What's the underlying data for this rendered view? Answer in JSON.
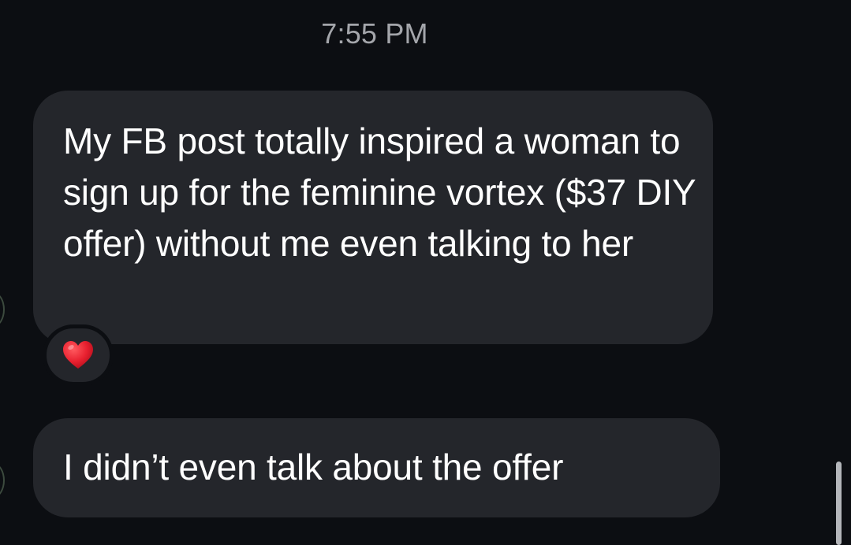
{
  "conversation": {
    "timestamp": "7:55 PM",
    "messages": [
      {
        "text": "My FB post totally inspired a woman to sign up for the feminine vortex ($37 DIY offer) without me even talking to her",
        "reaction": "red-heart"
      },
      {
        "text": "I didn’t even talk about the offer"
      }
    ]
  },
  "colors": {
    "background": "#0c0e12",
    "bubble": "#24262b",
    "timestamp": "#a4a6ab",
    "heart": "#e8202f"
  }
}
